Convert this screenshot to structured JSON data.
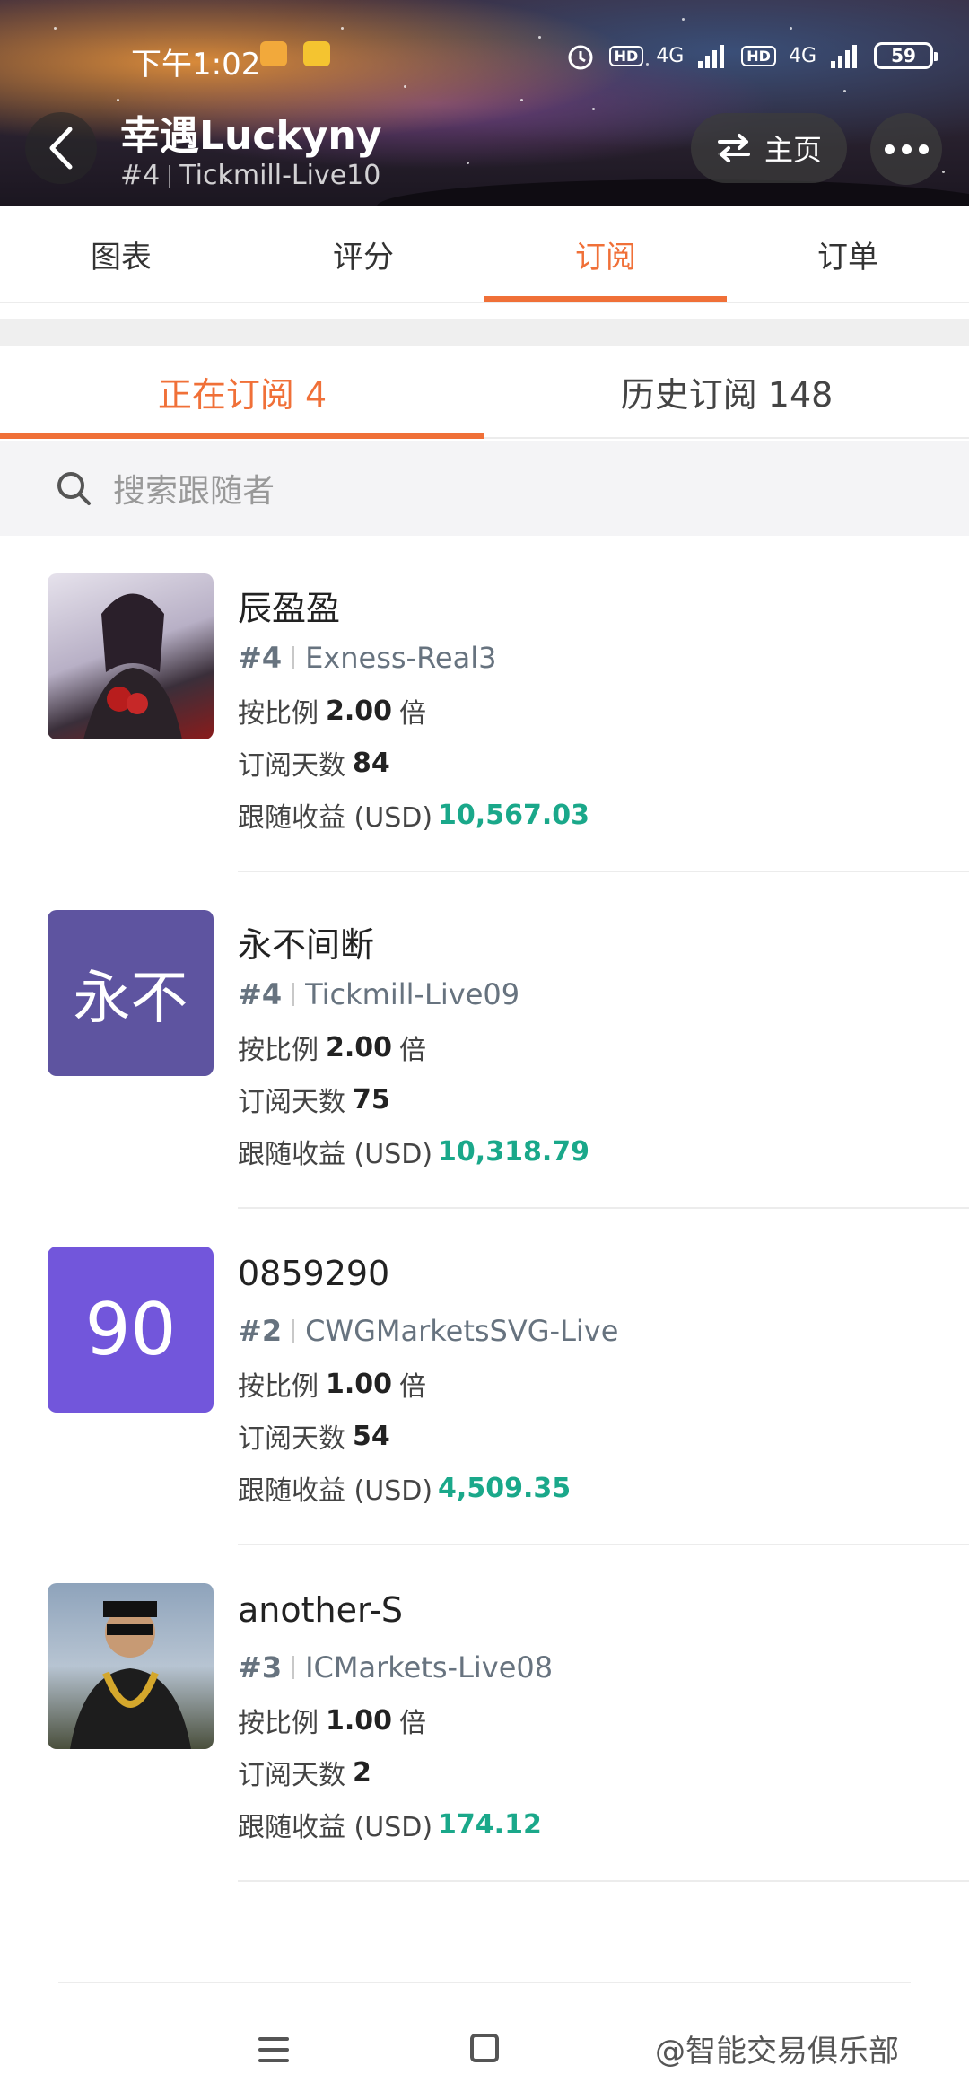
{
  "status": {
    "time": "下午1:02",
    "battery": "59",
    "net1": "4G",
    "net2": "4G",
    "hd": "HD"
  },
  "header": {
    "title": "幸遇Luckyny",
    "rank": "#4",
    "server": "Tickmill-Live10",
    "home_label": "主页"
  },
  "main_tabs": [
    "图表",
    "评分",
    "订阅",
    "订单"
  ],
  "main_tabs_active": 2,
  "sub_tabs": {
    "current": "正在订阅 4",
    "history": "历史订阅 148"
  },
  "search": {
    "placeholder": "搜索跟随者"
  },
  "labels": {
    "ratio": "按比例",
    "times": "倍",
    "days": "订阅天数",
    "profit": "跟随收益 (USD)"
  },
  "followers": [
    {
      "name": "辰盈盈",
      "rank": "#4",
      "server": "Exness-Real3",
      "ratio": "2.00",
      "days": "84",
      "profit": "10,567.03",
      "avatar_text": "",
      "avatar_type": "anime-icon",
      "avatar_color": "#c9c4d4"
    },
    {
      "name": "永不间断",
      "rank": "#4",
      "server": "Tickmill-Live09",
      "ratio": "2.00",
      "days": "75",
      "profit": "10,318.79",
      "avatar_text": "永不",
      "avatar_type": "text",
      "avatar_color": "#5e54a0"
    },
    {
      "name": "0859290",
      "rank": "#2",
      "server": "CWGMarketsSVG-Live",
      "ratio": "1.00",
      "days": "54",
      "profit": "4,509.35",
      "avatar_text": "90",
      "avatar_type": "text",
      "avatar_color": "#7256db"
    },
    {
      "name": "another-S",
      "rank": "#3",
      "server": "ICMarkets-Live08",
      "ratio": "1.00",
      "days": "2",
      "profit": "174.12",
      "avatar_text": "",
      "avatar_type": "photo-icon",
      "avatar_color": "#6e7f93"
    }
  ],
  "watermark": "@智能交易俱乐部",
  "colors": {
    "accent": "#f07038",
    "profit": "#1aa88a"
  }
}
